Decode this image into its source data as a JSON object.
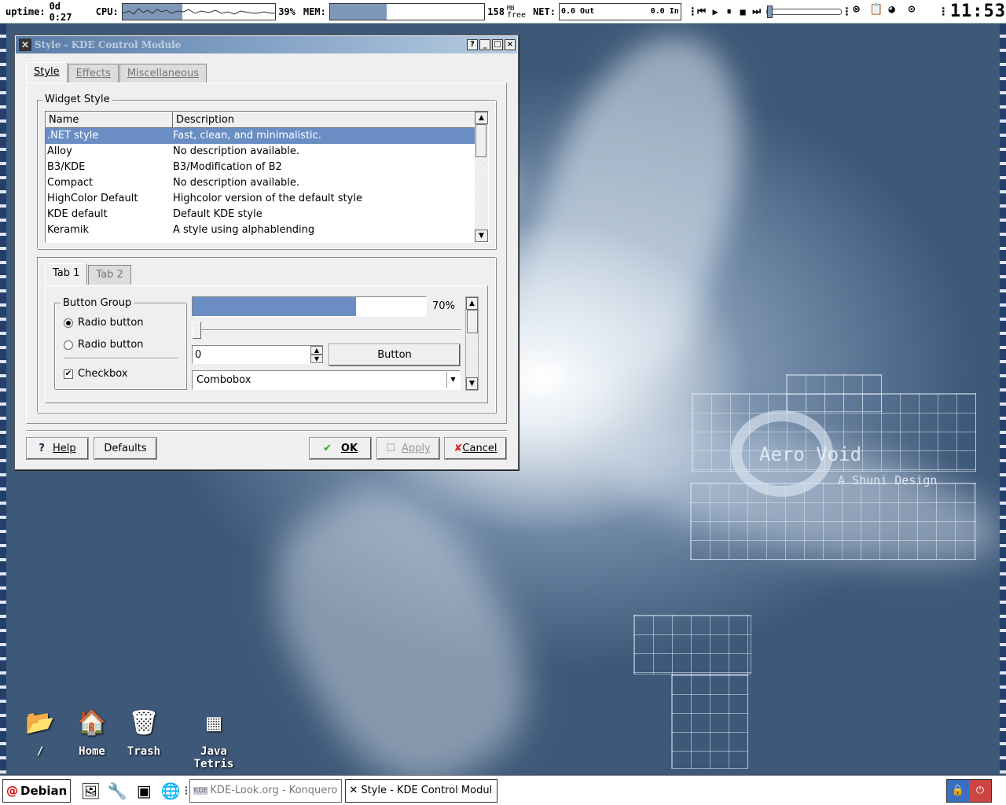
{
  "top_panel": {
    "uptime_label": "uptime:",
    "uptime_value": "0d 0:27",
    "cpu_label": "CPU:",
    "cpu_value": 39,
    "cpu_percent_text": "39%",
    "mem_label": "MEM:",
    "mem_free_value": "158",
    "mem_unit": "MB",
    "mem_free_label": "free",
    "mem_fill_fraction": 0.37,
    "net_label": "NET:",
    "net_out": "0.0 Out",
    "net_in": "0.0 In",
    "media_buttons": [
      "previous-icon",
      "play-icon",
      "pause-icon",
      "stop-icon",
      "next-icon"
    ],
    "volume_fraction": 0.0,
    "clock": "11:53"
  },
  "window": {
    "title": "Style - KDE Control Module",
    "title_buttons": [
      "?",
      "_",
      "□",
      "×"
    ],
    "tabs": [
      {
        "label": "Style",
        "active": true
      },
      {
        "label": "Effects",
        "active": false
      },
      {
        "label": "Miscellaneous",
        "active": false
      }
    ],
    "widget_style": {
      "group_title": "Widget Style",
      "columns": [
        "Name",
        "Description"
      ],
      "rows": [
        {
          "name": ".NET style",
          "desc": "Fast, clean, and minimalistic.",
          "selected": true
        },
        {
          "name": "Alloy",
          "desc": "No description available."
        },
        {
          "name": "B3/KDE",
          "desc": "B3/Modification of B2"
        },
        {
          "name": "Compact",
          "desc": "No description available."
        },
        {
          "name": "HighColor Default",
          "desc": "Highcolor version of the default style"
        },
        {
          "name": "KDE default",
          "desc": "Default KDE style"
        },
        {
          "name": "Keramik",
          "desc": "A style using alphablending"
        }
      ]
    },
    "preview": {
      "tabs": [
        "Tab 1",
        "Tab 2"
      ],
      "button_group_title": "Button Group",
      "radio1": "Radio button",
      "radio2": "Radio button",
      "checkbox": "Checkbox",
      "progress_value": 70,
      "progress_text": "70%",
      "spin_value": "0",
      "button_label": "Button",
      "combobox_value": "Combobox"
    },
    "buttons": {
      "help": "Help",
      "defaults": "Defaults",
      "ok": "OK",
      "apply": "Apply",
      "cancel": "Cancel"
    }
  },
  "desktop": {
    "watermark_title": "Aero Void",
    "watermark_subtitle": "A Shuni Design",
    "icons": [
      {
        "label": "/",
        "icon": "folder-icon"
      },
      {
        "label": "Home",
        "icon": "home-icon"
      },
      {
        "label": "Trash",
        "icon": "trash-icon"
      },
      {
        "label": "Java Tetris",
        "icon": "tetris-icon"
      }
    ]
  },
  "taskbar": {
    "start_label": "Debian",
    "tasks": [
      {
        "label": "KDE-Look.org - Konqueror",
        "active": false
      },
      {
        "label": "Style - KDE Control Modul",
        "active": true
      }
    ]
  },
  "colors": {
    "selection": "#6a8ec4",
    "titlebar": "#5a7ba6",
    "desktop": "#3e5878"
  }
}
